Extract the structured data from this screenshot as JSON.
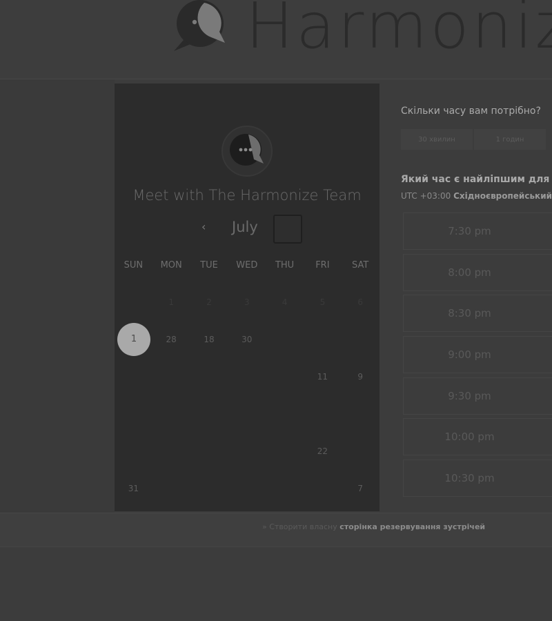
{
  "brand": {
    "logo_text": "Harmoniz"
  },
  "booking": {
    "title": "Meet with The Harmonize Team",
    "month": "July",
    "prev_icon": "‹",
    "weekdays": [
      "SUN",
      "MON",
      "TUE",
      "WED",
      "THU",
      "FRI",
      "SAT"
    ],
    "weeks": [
      [
        "",
        "1",
        "2",
        "3",
        "4",
        "5",
        "6"
      ],
      [
        "1",
        "28",
        "18",
        "30",
        "",
        "",
        ""
      ],
      [
        "",
        "",
        "",
        "",
        "",
        "11",
        "9"
      ],
      [
        "",
        "",
        "",
        "",
        "",
        "",
        ""
      ],
      [
        "",
        "",
        "",
        "",
        "",
        "22",
        ""
      ],
      [
        "31",
        "",
        "",
        "",
        "",
        "",
        "7"
      ]
    ],
    "today": {
      "week": 1,
      "day": 0
    }
  },
  "schedule": {
    "duration_question": "Скільки часу вам потрібно?",
    "durations": [
      "30 хвилин",
      "1 годин"
    ],
    "time_question": "Який час є найліпшим для ва",
    "timezone_prefix": "UTC +03:00",
    "timezone_name": "Східноєвропейський",
    "slots": [
      "7:30 pm",
      "8:00 pm",
      "8:30 pm",
      "9:00 pm",
      "9:30 pm",
      "10:00 pm",
      "10:30 pm"
    ]
  },
  "footer": {
    "arrow": "»",
    "prefix": "Створити власну",
    "link": "сторінка резервування зустрічей"
  },
  "icons": {
    "logo": "harmonize-chat-bubble-icon",
    "next": "chevron-right-icon"
  }
}
